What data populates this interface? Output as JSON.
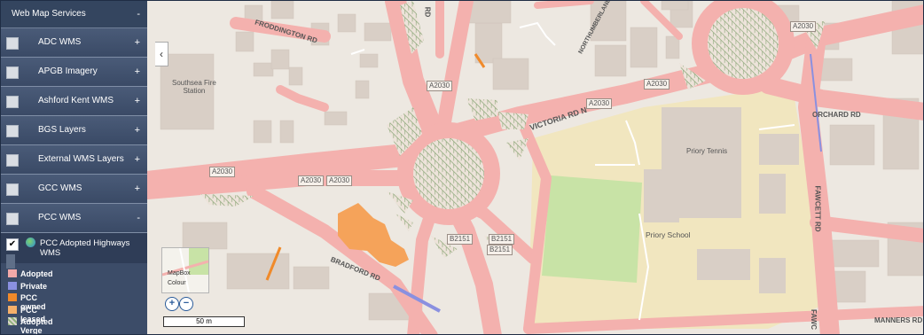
{
  "sidebar": {
    "header": {
      "label": "Web Map Services",
      "toggle": "-"
    },
    "layers": [
      {
        "label": "ADC WMS",
        "toggle": "+"
      },
      {
        "label": "APGB Imagery",
        "toggle": "+"
      },
      {
        "label": "Ashford Kent WMS",
        "toggle": "+"
      },
      {
        "label": "BGS Layers",
        "toggle": "+"
      },
      {
        "label": "External WMS Layers",
        "toggle": "+"
      },
      {
        "label": "GCC WMS",
        "toggle": "+"
      },
      {
        "label": "PCC WMS",
        "toggle": "-"
      }
    ],
    "sublayer": {
      "label": "PCC Adopted Highways WMS",
      "checked": "✔"
    },
    "legend": [
      {
        "label": "Adopted",
        "color": "#f2a9a9"
      },
      {
        "label": "Private",
        "color": "#8a90e0"
      },
      {
        "label": "PCC owned",
        "color": "#f08a2a"
      },
      {
        "label": "PCC leased",
        "color": "#f5b06a"
      },
      {
        "label": "Adopted Verge",
        "color": "#8fb07a"
      }
    ]
  },
  "map": {
    "collapse_icon": "‹",
    "thumbnail": {
      "line1": "MapBox",
      "line2": "Colour"
    },
    "zoom_in": "+",
    "zoom_out": "−",
    "scale": "50 m",
    "streets": {
      "froddington": "FRODDINGTON RD",
      "victoria": "VICTORIA RD N",
      "orchard": "ORCHARD RD",
      "fawcett": "FAWCETT RD",
      "bradford": "BRADFORD RD",
      "northumberland": "NORTHUMBERLAND",
      "rd": "RD",
      "fawc": "FAWC",
      "manners": "MANNERS RD"
    },
    "shields": {
      "a2030_1": "A2030",
      "a2030_2": "A2030",
      "a2030_3": "A2030",
      "a2030_4": "A2030",
      "a2030_5": "A2030",
      "a2030_6": "A2030",
      "a2030_7": "A2030",
      "b2151_1": "B2151",
      "b2151_2": "B2151",
      "b2151_3": "B2151"
    },
    "pois": {
      "fire_station": "Southsea Fire\nStation",
      "tennis": "Priory Tennis",
      "school": "Priory School"
    }
  }
}
